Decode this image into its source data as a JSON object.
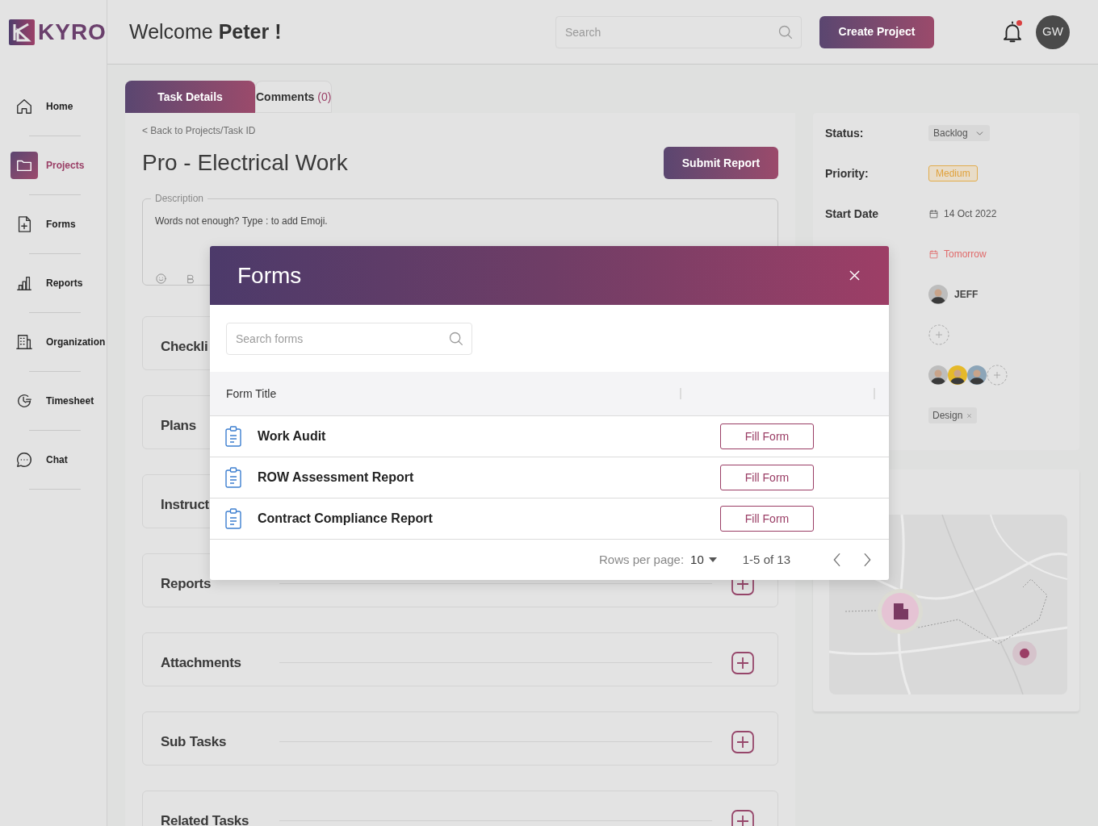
{
  "brand": {
    "name": "KYRO"
  },
  "sidebar": {
    "items": [
      {
        "label": "Home",
        "selected": false
      },
      {
        "label": "Projects",
        "selected": true
      },
      {
        "label": "Forms",
        "selected": false
      },
      {
        "label": "Reports",
        "selected": false
      },
      {
        "label": "Organization",
        "selected": false
      },
      {
        "label": "Timesheet",
        "selected": false
      },
      {
        "label": "Chat",
        "selected": false
      }
    ]
  },
  "header": {
    "greeting": "Welcome **Peter !**",
    "search": {
      "placeholder": "Search"
    },
    "create_button": "Create Project",
    "notifications": {
      "unread": true
    },
    "avatar": "GW"
  },
  "tabs": [
    {
      "label": "Task Details",
      "selected": true
    },
    {
      "label": "Comments",
      "count": "(0)",
      "selected": false
    }
  ],
  "task": {
    "back_link": "< Back to Projects/Task ID",
    "title": "Pro - Electrical Work",
    "submit_button": "Submit Report",
    "description": {
      "label": "Description",
      "placeholder": "Words not enough? Type : to add Emoji."
    },
    "sections": [
      {
        "title": "Checkli",
        "add_button": false
      },
      {
        "title": "Plans",
        "add_button": false
      },
      {
        "title": "Instruct",
        "add_button": false
      },
      {
        "title": "Reports",
        "add_button": true
      },
      {
        "title": "Attachments",
        "add_button": true
      },
      {
        "title": "Sub Tasks",
        "add_button": true
      },
      {
        "title": "Related Tasks",
        "add_button": true
      }
    ]
  },
  "details": {
    "rows": [
      {
        "kind": "status",
        "label": "Status:",
        "value": "Backlog"
      },
      {
        "kind": "priority",
        "label": "Priority:",
        "value": "Medium"
      },
      {
        "kind": "date",
        "label": "Start Date",
        "value": "14 Oct 2022"
      },
      {
        "kind": "due",
        "value": "Tomorrow"
      },
      {
        "kind": "assignee",
        "value": "JEFF"
      },
      {
        "kind": "add"
      },
      {
        "kind": "team"
      },
      {
        "kind": "tag",
        "value": "Design"
      }
    ]
  },
  "forms_dialog": {
    "title": "Forms",
    "search": {
      "placeholder": "Search forms"
    },
    "columns": [
      "Form Title"
    ],
    "rows": [
      {
        "title": "Work Audit",
        "action": "Fill Form"
      },
      {
        "title": "ROW Assessment Report",
        "action": "Fill Form"
      },
      {
        "title": "Contract Compliance Report",
        "action": "Fill Form"
      }
    ],
    "pagination": {
      "rows_label": "Rows per page:",
      "rows_value": "10",
      "range": "1-5 of 13"
    }
  }
}
